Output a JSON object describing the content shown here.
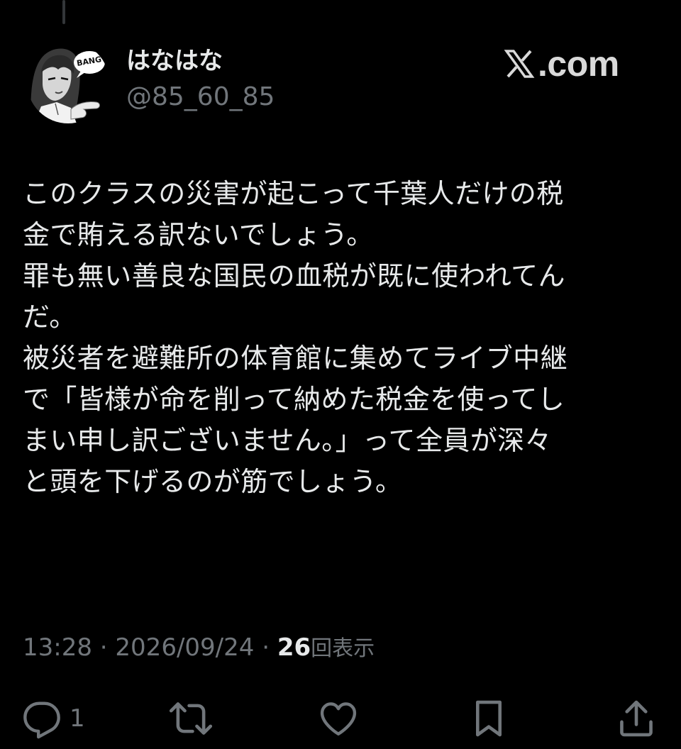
{
  "author": {
    "display_name": "はなはな",
    "handle": "@85_60_85",
    "avatar_caption": "BANG"
  },
  "watermark": {
    "text": ".com",
    "icon": "x-logo-icon"
  },
  "tweet": {
    "lines": [
      "このクラスの災害が起こって千葉人だけの税",
      "金で賄える訳ないでしょう。",
      "罪も無い善良な国民の血税が既に使われてん",
      "だ。",
      "被災者を避難所の体育館に集めてライブ中継",
      "で「皆様が命を削って納めた税金を使ってし",
      "まい申し訳ございません。」って全員が深々",
      "と頭を下げるのが筋でしょう。"
    ]
  },
  "meta": {
    "time": "13:28",
    "separator": "·",
    "date": "2026/09/24",
    "views_count": "26",
    "views_label": "回表示"
  },
  "actions": {
    "reply_count": "1",
    "reply_icon": "reply-icon",
    "retweet_icon": "retweet-icon",
    "like_icon": "heart-icon",
    "bookmark_icon": "bookmark-icon",
    "share_icon": "share-icon"
  },
  "colors": {
    "background": "#000000",
    "primary_text": "#e7e9ea",
    "secondary_text": "#71767b",
    "thread_line": "#333639"
  }
}
